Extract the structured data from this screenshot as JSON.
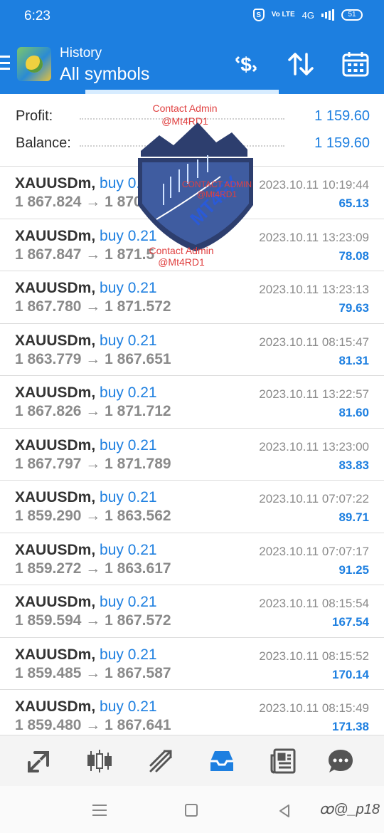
{
  "status": {
    "time": "6:23",
    "network": "4G",
    "volte": "Vo LTE",
    "battery": "51"
  },
  "header": {
    "subtitle": "History",
    "title": "All symbols"
  },
  "summary": {
    "profit_label": "Profit:",
    "profit_value": "1 159.60",
    "balance_label": "Balance:",
    "balance_value": "1 159.60"
  },
  "trades": [
    {
      "symbol": "XAUUSDm,",
      "side": "buy 0.21",
      "open": "1 867.824",
      "arrow": "→",
      "close": "1 870.92",
      "time": "2023.10.11 10:19:44",
      "profit": "65.13"
    },
    {
      "symbol": "XAUUSDm,",
      "side": "buy 0.21",
      "open": "1 867.847",
      "arrow": "→",
      "close": "1 871.5",
      "time": "2023.10.11 13:23:09",
      "profit": "78.08"
    },
    {
      "symbol": "XAUUSDm,",
      "side": "buy 0.21",
      "open": "1 867.780",
      "arrow": "→",
      "close": "1 871.572",
      "time": "2023.10.11 13:23:13",
      "profit": "79.63"
    },
    {
      "symbol": "XAUUSDm,",
      "side": "buy 0.21",
      "open": "1 863.779",
      "arrow": "→",
      "close": "1 867.651",
      "time": "2023.10.11 08:15:47",
      "profit": "81.31"
    },
    {
      "symbol": "XAUUSDm,",
      "side": "buy 0.21",
      "open": "1 867.826",
      "arrow": "→",
      "close": "1 871.712",
      "time": "2023.10.11 13:22:57",
      "profit": "81.60"
    },
    {
      "symbol": "XAUUSDm,",
      "side": "buy 0.21",
      "open": "1 867.797",
      "arrow": "→",
      "close": "1 871.789",
      "time": "2023.10.11 13:23:00",
      "profit": "83.83"
    },
    {
      "symbol": "XAUUSDm,",
      "side": "buy 0.21",
      "open": "1 859.290",
      "arrow": "→",
      "close": "1 863.562",
      "time": "2023.10.11 07:07:22",
      "profit": "89.71"
    },
    {
      "symbol": "XAUUSDm,",
      "side": "buy 0.21",
      "open": "1 859.272",
      "arrow": "→",
      "close": "1 863.617",
      "time": "2023.10.11 07:07:17",
      "profit": "91.25"
    },
    {
      "symbol": "XAUUSDm,",
      "side": "buy 0.21",
      "open": "1 859.594",
      "arrow": "→",
      "close": "1 867.572",
      "time": "2023.10.11 08:15:54",
      "profit": "167.54"
    },
    {
      "symbol": "XAUUSDm,",
      "side": "buy 0.21",
      "open": "1 859.485",
      "arrow": "→",
      "close": "1 867.587",
      "time": "2023.10.11 08:15:52",
      "profit": "170.14"
    },
    {
      "symbol": "XAUUSDm,",
      "side": "buy 0.21",
      "open": "1 859.480",
      "arrow": "→",
      "close": "1 867.641",
      "time": "2023.10.11 08:15:49",
      "profit": "171.38"
    }
  ],
  "watermark": {
    "line1": "Contact Admin",
    "line2": "@Mt4RD1",
    "line3": "CONTACT ADMIN",
    "line4": "@Mt4RD1",
    "line5": "Contact Admin",
    "line6": "@Mt4RD1",
    "logo": "MT4FX"
  },
  "credit": "ꝏ@_p18",
  "colors": {
    "accent": "#1d7fe0",
    "text": "#333333",
    "muted": "#8a8a8a",
    "watermark": "#e04040"
  },
  "icons": {
    "nav": [
      "quotes-icon",
      "chart-candles-icon",
      "trade-icon",
      "history-icon",
      "news-icon",
      "chat-icon"
    ],
    "actions": [
      "dollar-sign-icon",
      "sort-icon",
      "calendar-icon"
    ]
  }
}
